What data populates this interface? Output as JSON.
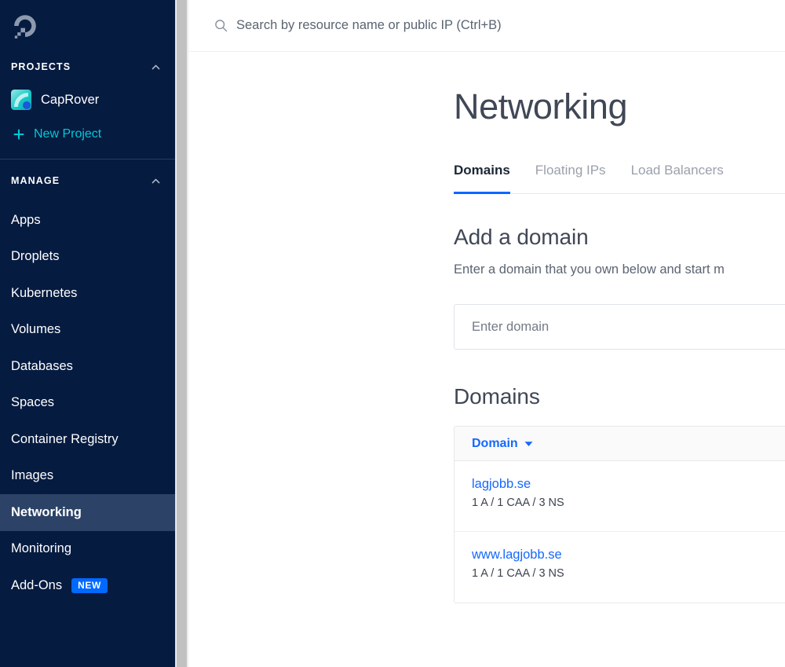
{
  "sidebar": {
    "logo_icon": "digitalocean-logo",
    "projects_section": {
      "title": "PROJECTS",
      "collapse_icon": "chevron-up-icon",
      "projects": [
        {
          "name": "CapRover",
          "icon": "project-icon"
        }
      ],
      "new_project_label": "New Project",
      "new_project_icon": "plus-icon"
    },
    "manage_section": {
      "title": "MANAGE",
      "collapse_icon": "chevron-up-icon",
      "items": [
        {
          "label": "Apps",
          "active": false
        },
        {
          "label": "Droplets",
          "active": false
        },
        {
          "label": "Kubernetes",
          "active": false
        },
        {
          "label": "Volumes",
          "active": false
        },
        {
          "label": "Databases",
          "active": false
        },
        {
          "label": "Spaces",
          "active": false
        },
        {
          "label": "Container Registry",
          "active": false
        },
        {
          "label": "Images",
          "active": false
        },
        {
          "label": "Networking",
          "active": true
        },
        {
          "label": "Monitoring",
          "active": false
        },
        {
          "label": "Add-Ons",
          "active": false,
          "badge": "NEW"
        }
      ]
    },
    "colors": {
      "background": "#061b40",
      "active_item": "#2c4267",
      "accent_cyan": "#00c9d7",
      "badge_blue": "#0069ff"
    }
  },
  "topbar": {
    "search_icon": "search-icon",
    "search_placeholder": "Search by resource name or public IP (Ctrl+B)",
    "search_value": ""
  },
  "main": {
    "page_title": "Networking",
    "tabs": [
      {
        "label": "Domains",
        "active": true
      },
      {
        "label": "Floating IPs",
        "active": false
      },
      {
        "label": "Load Balancers",
        "active": false
      }
    ],
    "add_domain": {
      "heading": "Add a domain",
      "description": "Enter a domain that you own below and start m",
      "input_placeholder": "Enter domain",
      "input_value": ""
    },
    "domains": {
      "heading": "Domains",
      "column_header": "Domain",
      "sort_icon": "caret-down-icon",
      "rows": [
        {
          "domain": "lagjobb.se",
          "records": "1 A / 1 CAA / 3 NS"
        },
        {
          "domain": "www.lagjobb.se",
          "records": "1 A / 1 CAA / 3 NS"
        }
      ]
    },
    "colors": {
      "link_blue": "#1668ff",
      "tab_active_underline": "#0069ff",
      "heading_gray": "#404756"
    }
  }
}
